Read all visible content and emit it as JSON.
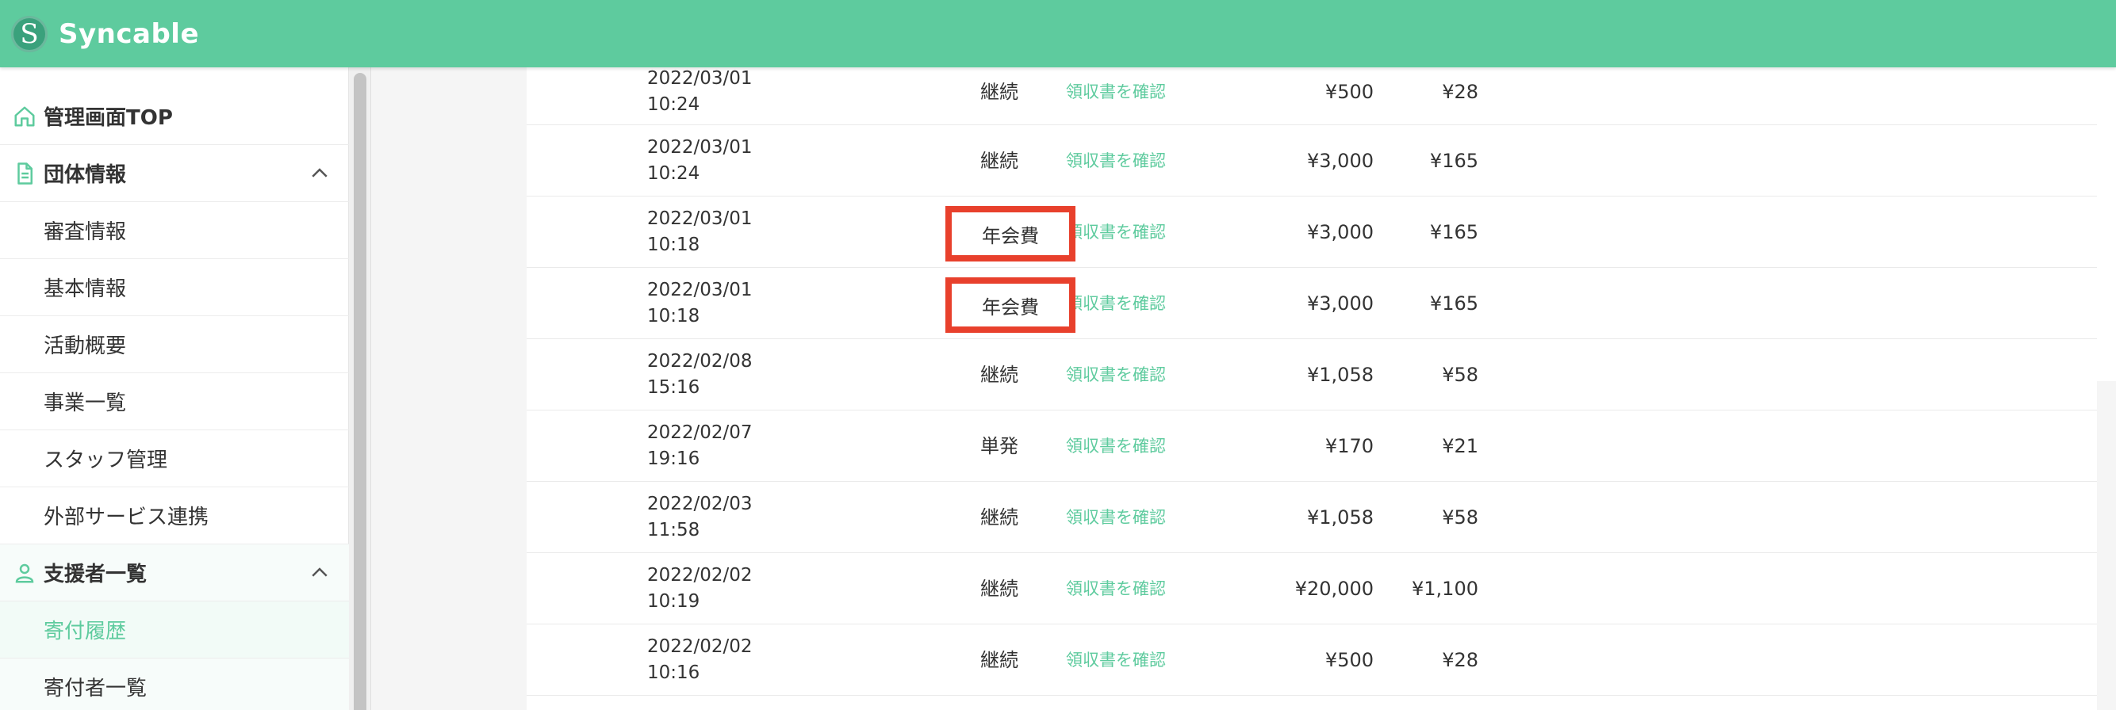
{
  "header": {
    "logo_letter": "S",
    "app_name": "Syncable"
  },
  "sidebar": {
    "top": "管理画面TOP",
    "group1": {
      "title": "団体情報",
      "items": [
        "審査情報",
        "基本情報",
        "活動概要",
        "事業一覧",
        "スタッフ管理",
        "外部サービス連携"
      ]
    },
    "group2": {
      "title": "支援者一覧",
      "items": [
        "寄付履歴",
        "寄付者一覧"
      ]
    }
  },
  "table": {
    "receipt_label": "領収書を確認",
    "rows": [
      {
        "date": "2022/03/01",
        "time": "10:24",
        "amount": "¥500",
        "fee": "¥28",
        "type": "継続"
      },
      {
        "date": "2022/03/01",
        "time": "10:24",
        "amount": "¥3,000",
        "fee": "¥165",
        "type": "継続"
      },
      {
        "date": "2022/03/01",
        "time": "10:18",
        "amount": "¥3,000",
        "fee": "¥165",
        "type": "年会費"
      },
      {
        "date": "2022/03/01",
        "time": "10:18",
        "amount": "¥3,000",
        "fee": "¥165",
        "type": "年会費"
      },
      {
        "date": "2022/02/08",
        "time": "15:16",
        "amount": "¥1,058",
        "fee": "¥58",
        "type": "継続"
      },
      {
        "date": "2022/02/07",
        "time": "19:16",
        "amount": "¥170",
        "fee": "¥21",
        "type": "単発"
      },
      {
        "date": "2022/02/03",
        "time": "11:58",
        "amount": "¥1,058",
        "fee": "¥58",
        "type": "継続"
      },
      {
        "date": "2022/02/02",
        "time": "10:19",
        "amount": "¥20,000",
        "fee": "¥1,100",
        "type": "継続"
      },
      {
        "date": "2022/02/02",
        "time": "10:16",
        "amount": "¥500",
        "fee": "¥28",
        "type": "継続"
      }
    ]
  },
  "colors": {
    "brand": "#5ecb9e",
    "highlight": "#e8402c"
  }
}
